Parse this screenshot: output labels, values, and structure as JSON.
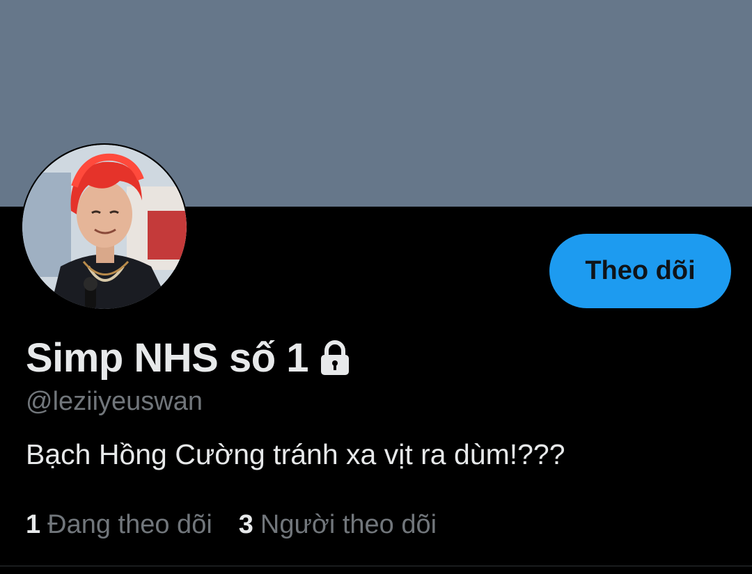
{
  "profile": {
    "display_name": "Simp NHS số 1",
    "handle": "@leziiyeuswan",
    "bio": "Bạch Hồng Cường tránh xa vịt ra dùm!???",
    "protected_icon": "lock-icon",
    "avatar_icon": "avatar"
  },
  "actions": {
    "follow_label": "Theo dõi"
  },
  "stats": {
    "following_count": "1",
    "following_label": "Đang theo dõi",
    "followers_count": "3",
    "followers_label": "Người theo dõi"
  },
  "colors": {
    "banner": "#66778a",
    "background": "#000000",
    "accent": "#1d9bf0",
    "primary_text": "#e7e9ea",
    "secondary_text": "#71767b"
  }
}
